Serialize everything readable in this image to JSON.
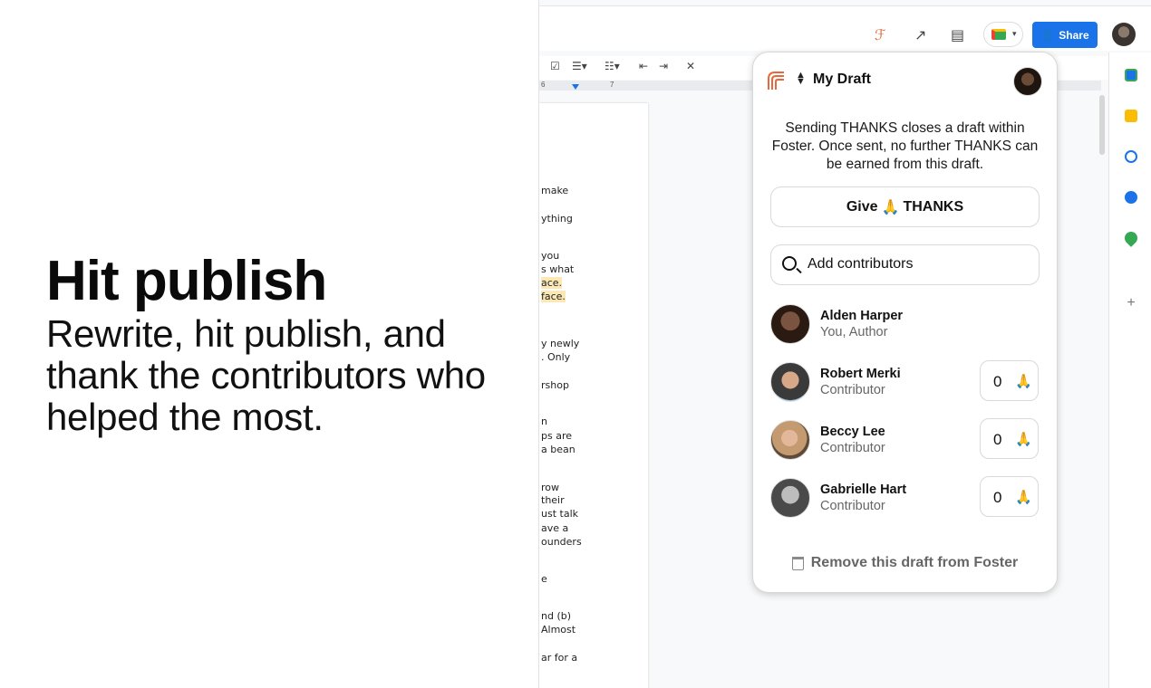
{
  "hero": {
    "title": "Hit publish",
    "subtitle": "Rewrite, hit publish, and thank the contributors who helped the most."
  },
  "docs": {
    "share_label": "Share",
    "ruler": {
      "tick_a": "6",
      "tick_b": "7"
    },
    "doc_lines": [
      "make",
      "ything",
      "you",
      "s what",
      "ace.",
      "face.",
      "y newly",
      ". Only",
      "rshop",
      "n",
      "ps are",
      "a bean",
      "row",
      " their",
      "ust talk",
      "ave a",
      "ounders",
      "e",
      "nd (b)",
      "Almost",
      "ar for a"
    ]
  },
  "panel": {
    "draft_title": "My Draft",
    "notice": "Sending THANKS closes a draft within Foster. Once sent, no further THANKS can be earned from this draft.",
    "give_label": "Give",
    "give_emoji": "🙏",
    "thanks_label": "THANKS",
    "search_placeholder": "Add contributors",
    "contributors": [
      {
        "name": "Alden Harper",
        "role": "You, Author"
      },
      {
        "name": "Robert Merki",
        "role": "Contributor",
        "count": "0",
        "emoji": "🙏"
      },
      {
        "name": "Beccy Lee",
        "role": "Contributor",
        "count": "0",
        "emoji": "🙏"
      },
      {
        "name": "Gabrielle Hart",
        "role": "Contributor",
        "count": "0",
        "emoji": "🙏"
      }
    ],
    "remove_label": "Remove this draft from Foster"
  },
  "colors": {
    "share_blue": "#1a73e8",
    "foster_orange": "#e8673c"
  }
}
